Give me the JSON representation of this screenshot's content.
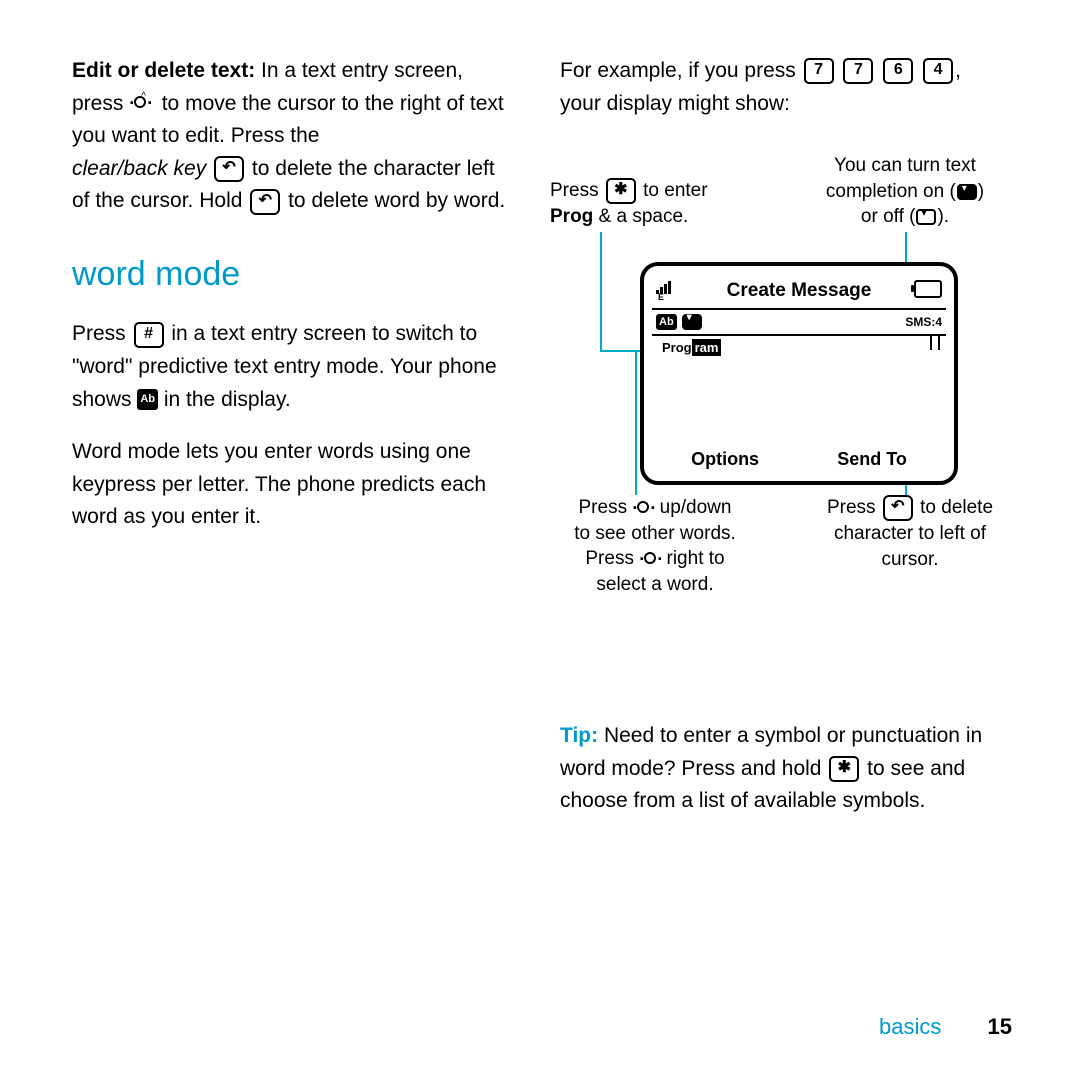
{
  "leftCol": {
    "editDeleteLabel": "Edit or delete text:",
    "editDelete1": " In a text entry screen, press ",
    "editDelete2": " to move the cursor to the right of text you want to edit. Press the",
    "clearBackKey": "clear/back key",
    "editDelete3": " to delete the character left of the cursor. Hold ",
    "editDelete4": " to delete word by word.",
    "heading": "word mode",
    "wm1a": "Press ",
    "wm1b": " in a text entry screen to switch to \"word\" predictive text entry mode. Your phone shows ",
    "wm1c": " in the display.",
    "wm2": "Word mode lets you enter words using one keypress per letter. The phone predicts each word as you enter it."
  },
  "rightCol": {
    "example1": "For example, if you press ",
    "keys": [
      "7",
      "7",
      "6",
      "4"
    ],
    "example2": ", your display might show:",
    "tipLabel": "Tip:",
    "tip1": " Need to enter a symbol or punctuation in word mode? Press and hold ",
    "tip2": " to see and choose from a list of available symbols."
  },
  "diagram": {
    "annTopLeft1": "Press ",
    "annTopLeft2": " to enter",
    "annTopLeft3": "Prog",
    "annTopLeft4": " & a space.",
    "annTopRight1": "You can turn text",
    "annTopRight2": "completion on (",
    "annTopRight3": ")",
    "annTopRight4": "or off (",
    "annTopRight5": ").",
    "annBotLeft1": "Press ",
    "annBotLeft2": " up/down",
    "annBotLeft3": "to see other words.",
    "annBotLeft4": "Press ",
    "annBotLeft5": " right to",
    "annBotLeft6": "select a word.",
    "annBotRight1": "Press ",
    "annBotRight2": " to delete",
    "annBotRight3": "character to left of",
    "annBotRight4": "cursor.",
    "title": "Create Message",
    "sms": "SMS:4",
    "typed": "Prog",
    "predicted": "ram",
    "softLeft": "Options",
    "softRight": "Send To",
    "abIcon": "Ab"
  },
  "footer": {
    "section": "basics",
    "page": "15"
  }
}
